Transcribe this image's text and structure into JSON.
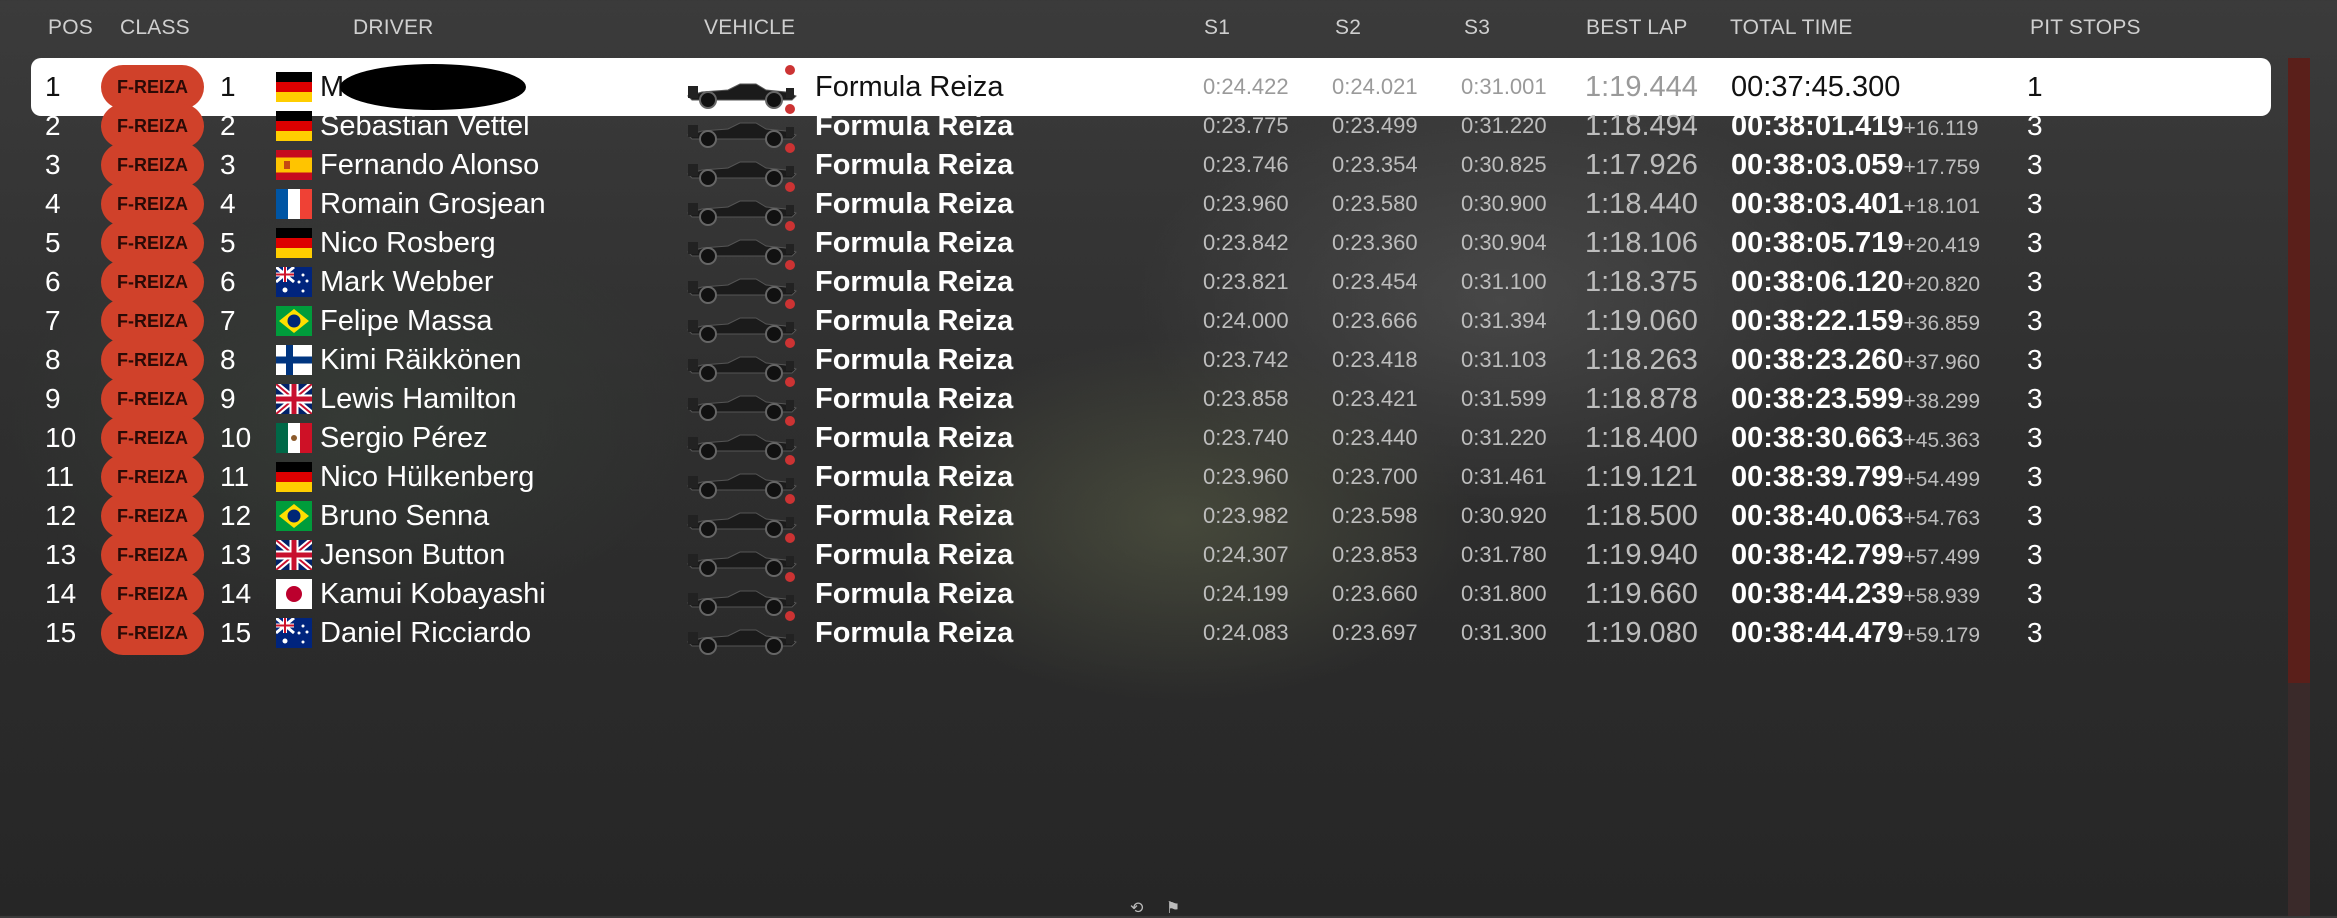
{
  "columns": {
    "pos": "POS",
    "class": "CLASS",
    "driver": "DRIVER",
    "vehicle": "VEHICLE",
    "s1": "S1",
    "s2": "S2",
    "s3": "S3",
    "best_lap": "BEST LAP",
    "total_time": "TOTAL TIME",
    "pit_stops": "PIT STOPS"
  },
  "colors": {
    "class_badge": "#d0412a",
    "highlight_row": "#ffffff",
    "scroll_thumb": "#5a1f1a"
  },
  "rows": [
    {
      "pos": "1",
      "class": "F-REIZA",
      "num": "1",
      "flag": "de-flag-icon",
      "driver": "M",
      "redacted": true,
      "vehicle": "Formula Reiza",
      "s1": "0:24.422",
      "s2": "0:24.021",
      "s3": "0:31.001",
      "best": "1:19.444",
      "total": "00:37:45.300",
      "gap": "",
      "pits": "1",
      "highlight": true
    },
    {
      "pos": "2",
      "class": "F-REIZA",
      "num": "2",
      "flag": "de-flag-icon",
      "driver": "Sebastian Vettel",
      "vehicle": "Formula Reiza",
      "s1": "0:23.775",
      "s2": "0:23.499",
      "s3": "0:31.220",
      "best": "1:18.494",
      "total": "00:38:01.419",
      "gap": "+16.119",
      "pits": "3"
    },
    {
      "pos": "3",
      "class": "F-REIZA",
      "num": "3",
      "flag": "es-flag-icon",
      "driver": "Fernando Alonso",
      "vehicle": "Formula Reiza",
      "s1": "0:23.746",
      "s2": "0:23.354",
      "s3": "0:30.825",
      "best": "1:17.926",
      "total": "00:38:03.059",
      "gap": "+17.759",
      "pits": "3"
    },
    {
      "pos": "4",
      "class": "F-REIZA",
      "num": "4",
      "flag": "fr-flag-icon",
      "driver": "Romain Grosjean",
      "vehicle": "Formula Reiza",
      "s1": "0:23.960",
      "s2": "0:23.580",
      "s3": "0:30.900",
      "best": "1:18.440",
      "total": "00:38:03.401",
      "gap": "+18.101",
      "pits": "3"
    },
    {
      "pos": "5",
      "class": "F-REIZA",
      "num": "5",
      "flag": "de-flag-icon",
      "driver": "Nico Rosberg",
      "vehicle": "Formula Reiza",
      "s1": "0:23.842",
      "s2": "0:23.360",
      "s3": "0:30.904",
      "best": "1:18.106",
      "total": "00:38:05.719",
      "gap": "+20.419",
      "pits": "3"
    },
    {
      "pos": "6",
      "class": "F-REIZA",
      "num": "6",
      "flag": "au-flag-icon",
      "driver": "Mark Webber",
      "vehicle": "Formula Reiza",
      "s1": "0:23.821",
      "s2": "0:23.454",
      "s3": "0:31.100",
      "best": "1:18.375",
      "total": "00:38:06.120",
      "gap": "+20.820",
      "pits": "3"
    },
    {
      "pos": "7",
      "class": "F-REIZA",
      "num": "7",
      "flag": "br-flag-icon",
      "driver": "Felipe Massa",
      "vehicle": "Formula Reiza",
      "s1": "0:24.000",
      "s2": "0:23.666",
      "s3": "0:31.394",
      "best": "1:19.060",
      "total": "00:38:22.159",
      "gap": "+36.859",
      "pits": "3"
    },
    {
      "pos": "8",
      "class": "F-REIZA",
      "num": "8",
      "flag": "fi-flag-icon",
      "driver": "Kimi Räikkönen",
      "vehicle": "Formula Reiza",
      "s1": "0:23.742",
      "s2": "0:23.418",
      "s3": "0:31.103",
      "best": "1:18.263",
      "total": "00:38:23.260",
      "gap": "+37.960",
      "pits": "3"
    },
    {
      "pos": "9",
      "class": "F-REIZA",
      "num": "9",
      "flag": "gb-flag-icon",
      "driver": "Lewis Hamilton",
      "vehicle": "Formula Reiza",
      "s1": "0:23.858",
      "s2": "0:23.421",
      "s3": "0:31.599",
      "best": "1:18.878",
      "total": "00:38:23.599",
      "gap": "+38.299",
      "pits": "3"
    },
    {
      "pos": "10",
      "class": "F-REIZA",
      "num": "10",
      "flag": "mx-flag-icon",
      "driver": "Sergio Pérez",
      "vehicle": "Formula Reiza",
      "s1": "0:23.740",
      "s2": "0:23.440",
      "s3": "0:31.220",
      "best": "1:18.400",
      "total": "00:38:30.663",
      "gap": "+45.363",
      "pits": "3"
    },
    {
      "pos": "11",
      "class": "F-REIZA",
      "num": "11",
      "flag": "de-flag-icon",
      "driver": "Nico Hülkenberg",
      "vehicle": "Formula Reiza",
      "s1": "0:23.960",
      "s2": "0:23.700",
      "s3": "0:31.461",
      "best": "1:19.121",
      "total": "00:38:39.799",
      "gap": "+54.499",
      "pits": "3"
    },
    {
      "pos": "12",
      "class": "F-REIZA",
      "num": "12",
      "flag": "br-flag-icon",
      "driver": "Bruno Senna",
      "vehicle": "Formula Reiza",
      "s1": "0:23.982",
      "s2": "0:23.598",
      "s3": "0:30.920",
      "best": "1:18.500",
      "total": "00:38:40.063",
      "gap": "+54.763",
      "pits": "3"
    },
    {
      "pos": "13",
      "class": "F-REIZA",
      "num": "13",
      "flag": "gb-flag-icon",
      "driver": "Jenson Button",
      "vehicle": "Formula Reiza",
      "s1": "0:24.307",
      "s2": "0:23.853",
      "s3": "0:31.780",
      "best": "1:19.940",
      "total": "00:38:42.799",
      "gap": "+57.499",
      "pits": "3"
    },
    {
      "pos": "14",
      "class": "F-REIZA",
      "num": "14",
      "flag": "jp-flag-icon",
      "driver": "Kamui Kobayashi",
      "vehicle": "Formula Reiza",
      "s1": "0:24.199",
      "s2": "0:23.660",
      "s3": "0:31.800",
      "best": "1:19.660",
      "total": "00:38:44.239",
      "gap": "+58.939",
      "pits": "3"
    },
    {
      "pos": "15",
      "class": "F-REIZA",
      "num": "15",
      "flag": "au-flag-icon",
      "driver": "Daniel Ricciardo",
      "vehicle": "Formula Reiza",
      "s1": "0:24.083",
      "s2": "0:23.697",
      "s3": "0:31.300",
      "best": "1:19.080",
      "total": "00:38:44.479",
      "gap": "+59.179",
      "pits": "3"
    }
  ]
}
